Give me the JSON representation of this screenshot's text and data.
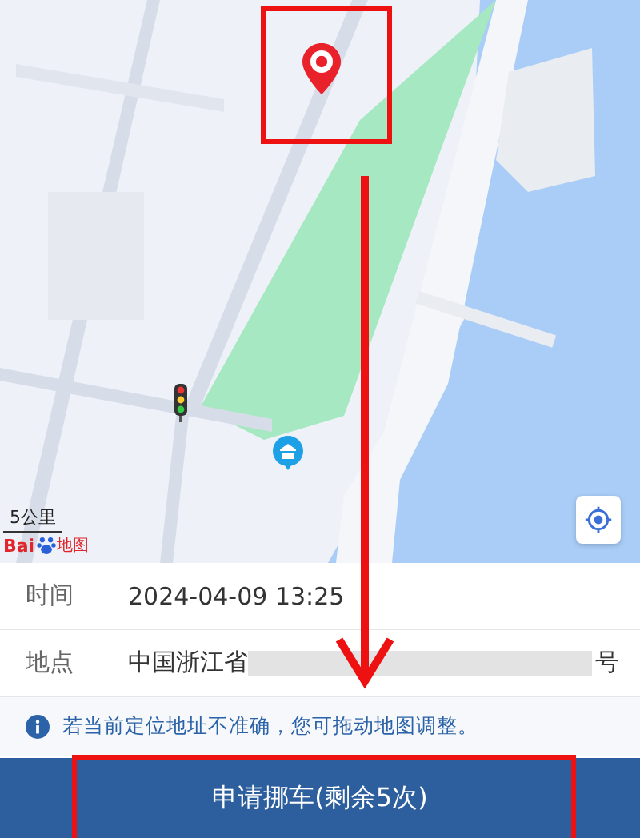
{
  "map": {
    "scale": "5公里",
    "logo": {
      "brand": "Bai",
      "product": "地图"
    }
  },
  "rows": [
    {
      "label": "时间",
      "value": "2024-04-09 13:25",
      "redacted": false,
      "suffix": ""
    },
    {
      "label": "地点",
      "value": "中国浙江省",
      "redacted": true,
      "suffix": "号"
    }
  ],
  "hint": "若当前定位地址不准确，您可拖动地图调整。",
  "submit": "申请挪车(剩余5次)"
}
